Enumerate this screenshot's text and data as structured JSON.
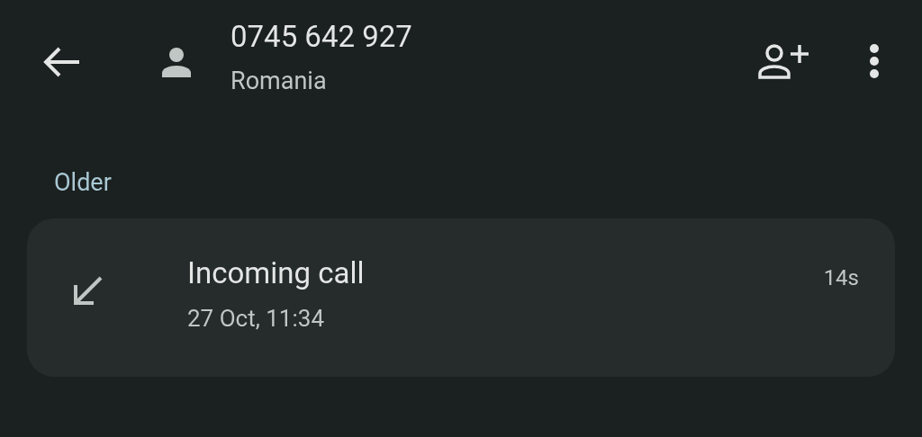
{
  "header": {
    "number": "0745 642 927",
    "location": "Romania"
  },
  "section": {
    "title": "Older"
  },
  "calls": [
    {
      "kind": "incoming",
      "title": "Incoming call",
      "time": "27 Oct, 11:34",
      "duration": "14s"
    }
  ]
}
